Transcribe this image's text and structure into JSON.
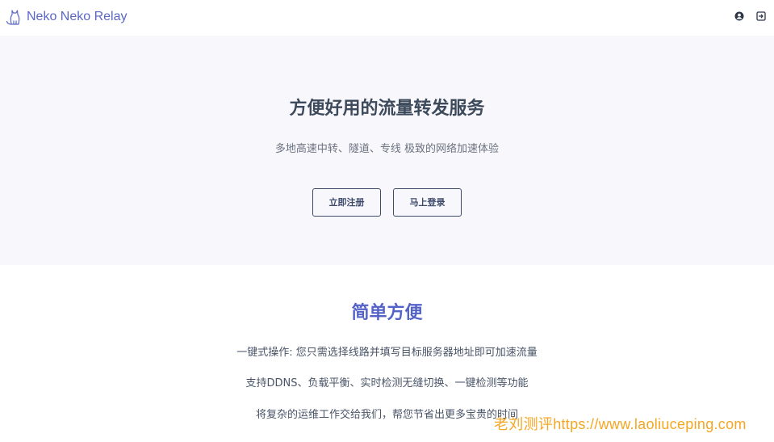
{
  "navbar": {
    "brand_name": "Neko Neko Relay",
    "brand_logo_icon": "cat-outline-icon",
    "account_icon": "user-circle-icon",
    "logout_icon": "logout-door-icon"
  },
  "hero": {
    "title": "方便好用的流量转发服务",
    "subtitle": "多地高速中转、隧道、专线 极致的网络加速体验",
    "register_label": "立即注册",
    "login_label": "马上登录"
  },
  "features": {
    "title": "简单方便",
    "items": [
      "一键式操作: 您只需选择线路并填写目标服务器地址即可加速流量",
      "支持DDNS、负载平衡、实时检测无缝切换、一键检测等功能",
      "将复杂的运维工作交给我们，帮您节省出更多宝贵的时间"
    ]
  },
  "watermark": {
    "text": "老刘测评https://www.laoliuceping.com"
  },
  "colors": {
    "brand": "#5a67c4",
    "hero_bg": "#f8f8fc",
    "button_border": "#3d4a6b",
    "feature_title": "#5562c7",
    "watermark": "#f5a623"
  }
}
